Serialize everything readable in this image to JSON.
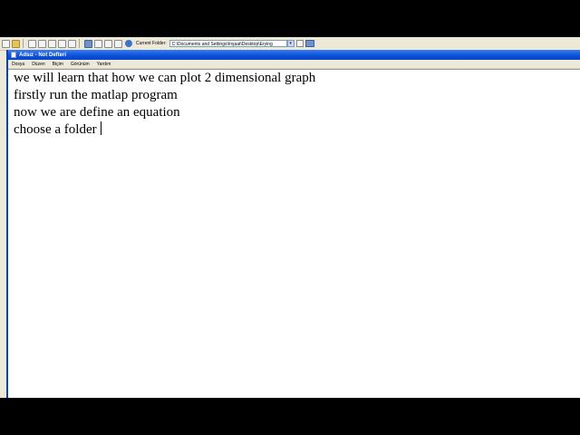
{
  "matlab_toolbar": {
    "current_folder_label": "Current Folder:",
    "current_folder_value": "C:\\Documents and Settings\\Inşaat\\Desktop\\Erying"
  },
  "notepad": {
    "title": "Adsız - Not Defteri",
    "menu": [
      "Dosya",
      "Düzen",
      "Biçim",
      "Görünüm",
      "Yardım"
    ],
    "lines": [
      "we will learn that how we can plot 2 dimensional graph",
      "firstly run the matlap program",
      "now we are define an equation",
      "choose a folder"
    ]
  },
  "colors": {
    "titlebar": "#0a4fd8",
    "chrome": "#ece9d8",
    "letterbox": "#000000"
  }
}
